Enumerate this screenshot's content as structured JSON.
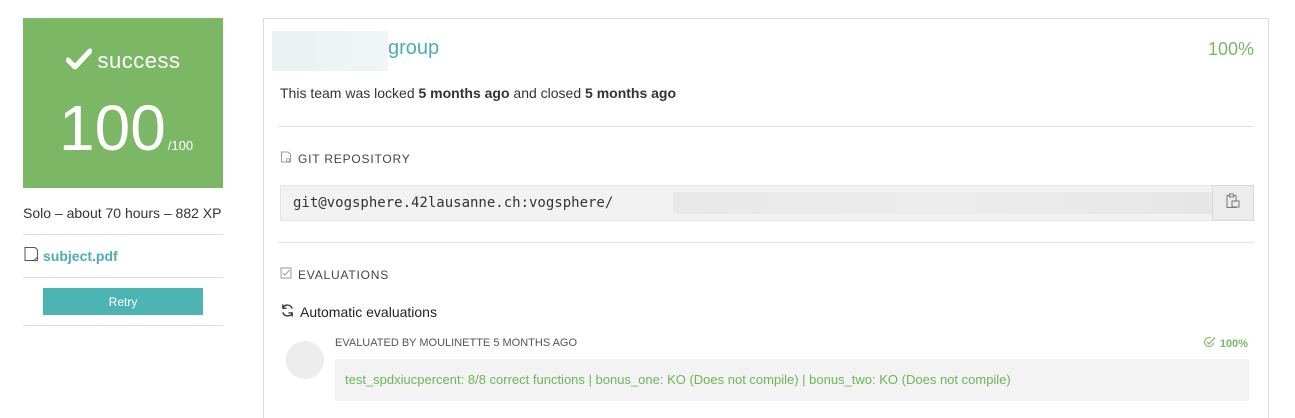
{
  "score_card": {
    "status": "success",
    "score": "100",
    "max": "/100",
    "color": "#7bb765"
  },
  "project_meta": "Solo – about 70 hours – 882 XP",
  "subject_link": "subject.pdf",
  "retry_label": "Retry",
  "team": {
    "name": "group",
    "percent": "100%",
    "lock_prefix": "This team was locked ",
    "locked_when": "5 months ago",
    "lock_mid": " and closed ",
    "closed_when": "5 months ago"
  },
  "git": {
    "section_title": "GIT REPOSITORY",
    "url": "git@vogsphere.42lausanne.ch:vogsphere/"
  },
  "evaluations": {
    "section_title": "EVALUATIONS",
    "auto_title": "Automatic evaluations",
    "evaluated_by": "EVALUATED BY MOULINETTE 5 MONTHS AGO",
    "percent": "100%",
    "result": "test_spdxiucpercent: 8/8 correct functions | bonus_one: KO (Does not compile) | bonus_two: KO (Does not compile)"
  },
  "colors": {
    "accent_teal": "#4aaeb4",
    "success_green": "#7bb765"
  },
  "icons": [
    "check-icon",
    "file-icon",
    "repo-icon",
    "clipboard-icon",
    "checkbox-icon",
    "refresh-icon",
    "check-circle-icon"
  ]
}
